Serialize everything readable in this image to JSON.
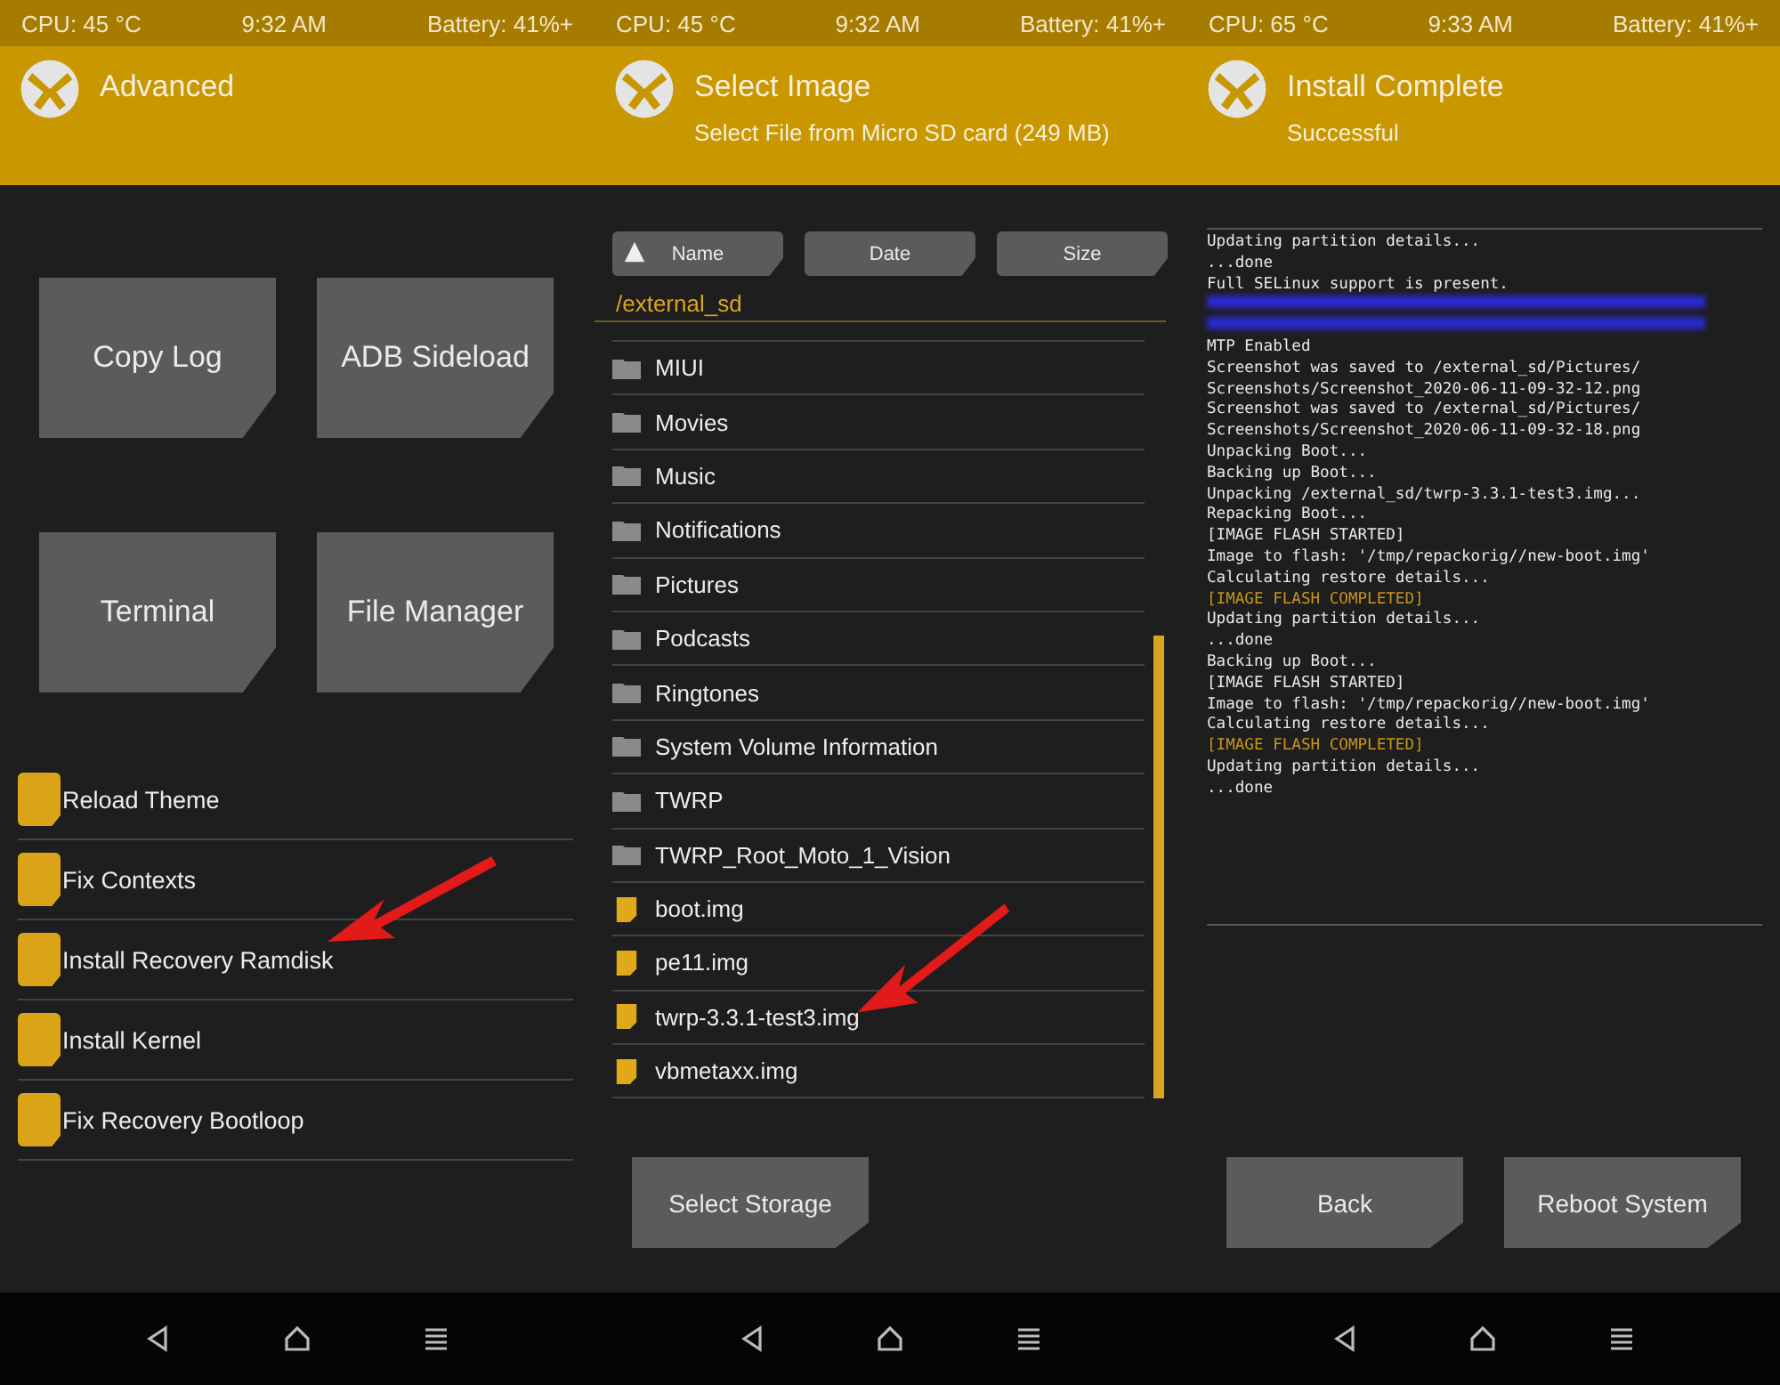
{
  "panels": [
    {
      "kind": "advanced",
      "status": {
        "cpu": "CPU: 45 °C",
        "time": "9:32 AM",
        "battery": "Battery: 41%+"
      },
      "title": "Advanced",
      "buttons": [
        "Copy Log",
        "ADB Sideload",
        "Terminal",
        "File Manager"
      ],
      "items": [
        {
          "label": "Reload Theme",
          "arrow": false
        },
        {
          "label": "Fix Contexts",
          "arrow": false
        },
        {
          "label": "Install Recovery Ramdisk",
          "arrow": true
        },
        {
          "label": "Install Kernel",
          "arrow": false
        },
        {
          "label": "Fix Recovery Bootloop",
          "arrow": false
        }
      ]
    },
    {
      "kind": "files",
      "status": {
        "cpu": "CPU: 45 °C",
        "time": "9:32 AM",
        "battery": "Battery: 41%+"
      },
      "title": "Select Image",
      "subtitle": "Select File from Micro SD card (249 MB)",
      "sort_buttons": [
        {
          "label": "Name",
          "selected": true
        },
        {
          "label": "Date",
          "selected": false
        },
        {
          "label": "Size",
          "selected": false
        }
      ],
      "path": "/external_sd",
      "files": [
        {
          "name": "MIUI",
          "kind": "folder",
          "arrow": false
        },
        {
          "name": "Movies",
          "kind": "folder",
          "arrow": false
        },
        {
          "name": "Music",
          "kind": "folder",
          "arrow": false
        },
        {
          "name": "Notifications",
          "kind": "folder",
          "arrow": false
        },
        {
          "name": "Pictures",
          "kind": "folder",
          "arrow": false
        },
        {
          "name": "Podcasts",
          "kind": "folder",
          "arrow": false
        },
        {
          "name": "Ringtones",
          "kind": "folder",
          "arrow": false
        },
        {
          "name": "System Volume Information",
          "kind": "folder",
          "arrow": false
        },
        {
          "name": "TWRP",
          "kind": "folder",
          "arrow": false
        },
        {
          "name": "TWRP_Root_Moto_1_Vision",
          "kind": "folder",
          "arrow": false
        },
        {
          "name": "boot.img",
          "kind": "file",
          "arrow": false
        },
        {
          "name": "pe11.img",
          "kind": "file",
          "arrow": false
        },
        {
          "name": "twrp-3.3.1-test3.img",
          "kind": "file",
          "arrow": true
        },
        {
          "name": "vbmetaxx.img",
          "kind": "file",
          "arrow": false
        }
      ],
      "buttons": [
        "Select Storage"
      ]
    },
    {
      "kind": "log",
      "status": {
        "cpu": "CPU: 65 °C",
        "time": "9:33 AM",
        "battery": "Battery: 41%+"
      },
      "title": "Install Complete",
      "subtitle": "Successful",
      "log": [
        {
          "kind": "normal",
          "text": "Updating partition details..."
        },
        {
          "kind": "normal",
          "text": "...done"
        },
        {
          "kind": "normal",
          "text": "Full SELinux support is present."
        },
        {
          "kind": "redacted"
        },
        {
          "kind": "redacted"
        },
        {
          "kind": "normal",
          "text": "MTP Enabled"
        },
        {
          "kind": "normal",
          "text": "Screenshot was saved to /external_sd/Pictures/"
        },
        {
          "kind": "normal",
          "text": "Screenshots/Screenshot_2020-06-11-09-32-12.png"
        },
        {
          "kind": "normal",
          "text": "Screenshot was saved to /external_sd/Pictures/"
        },
        {
          "kind": "normal",
          "text": "Screenshots/Screenshot_2020-06-11-09-32-18.png"
        },
        {
          "kind": "normal",
          "text": "Unpacking Boot..."
        },
        {
          "kind": "normal",
          "text": "Backing up Boot..."
        },
        {
          "kind": "normal",
          "text": "Unpacking /external_sd/twrp-3.3.1-test3.img..."
        },
        {
          "kind": "normal",
          "text": "Repacking Boot..."
        },
        {
          "kind": "normal",
          "text": "[IMAGE FLASH STARTED]"
        },
        {
          "kind": "normal",
          "text": "Image to flash: '/tmp/repackorig//new-boot.img'"
        },
        {
          "kind": "normal",
          "text": "Calculating restore details..."
        },
        {
          "kind": "highlight",
          "text": "[IMAGE FLASH COMPLETED]"
        },
        {
          "kind": "normal",
          "text": "Updating partition details..."
        },
        {
          "kind": "normal",
          "text": "...done"
        },
        {
          "kind": "normal",
          "text": "Backing up Boot..."
        },
        {
          "kind": "normal",
          "text": "[IMAGE FLASH STARTED]"
        },
        {
          "kind": "normal",
          "text": "Image to flash: '/tmp/repackorig//new-boot.img'"
        },
        {
          "kind": "normal",
          "text": "Calculating restore details..."
        },
        {
          "kind": "highlight",
          "text": "[IMAGE FLASH COMPLETED]"
        },
        {
          "kind": "normal",
          "text": "Updating partition details..."
        },
        {
          "kind": "normal",
          "text": "...done"
        }
      ],
      "buttons": [
        "Back",
        "Reboot System"
      ]
    }
  ]
}
